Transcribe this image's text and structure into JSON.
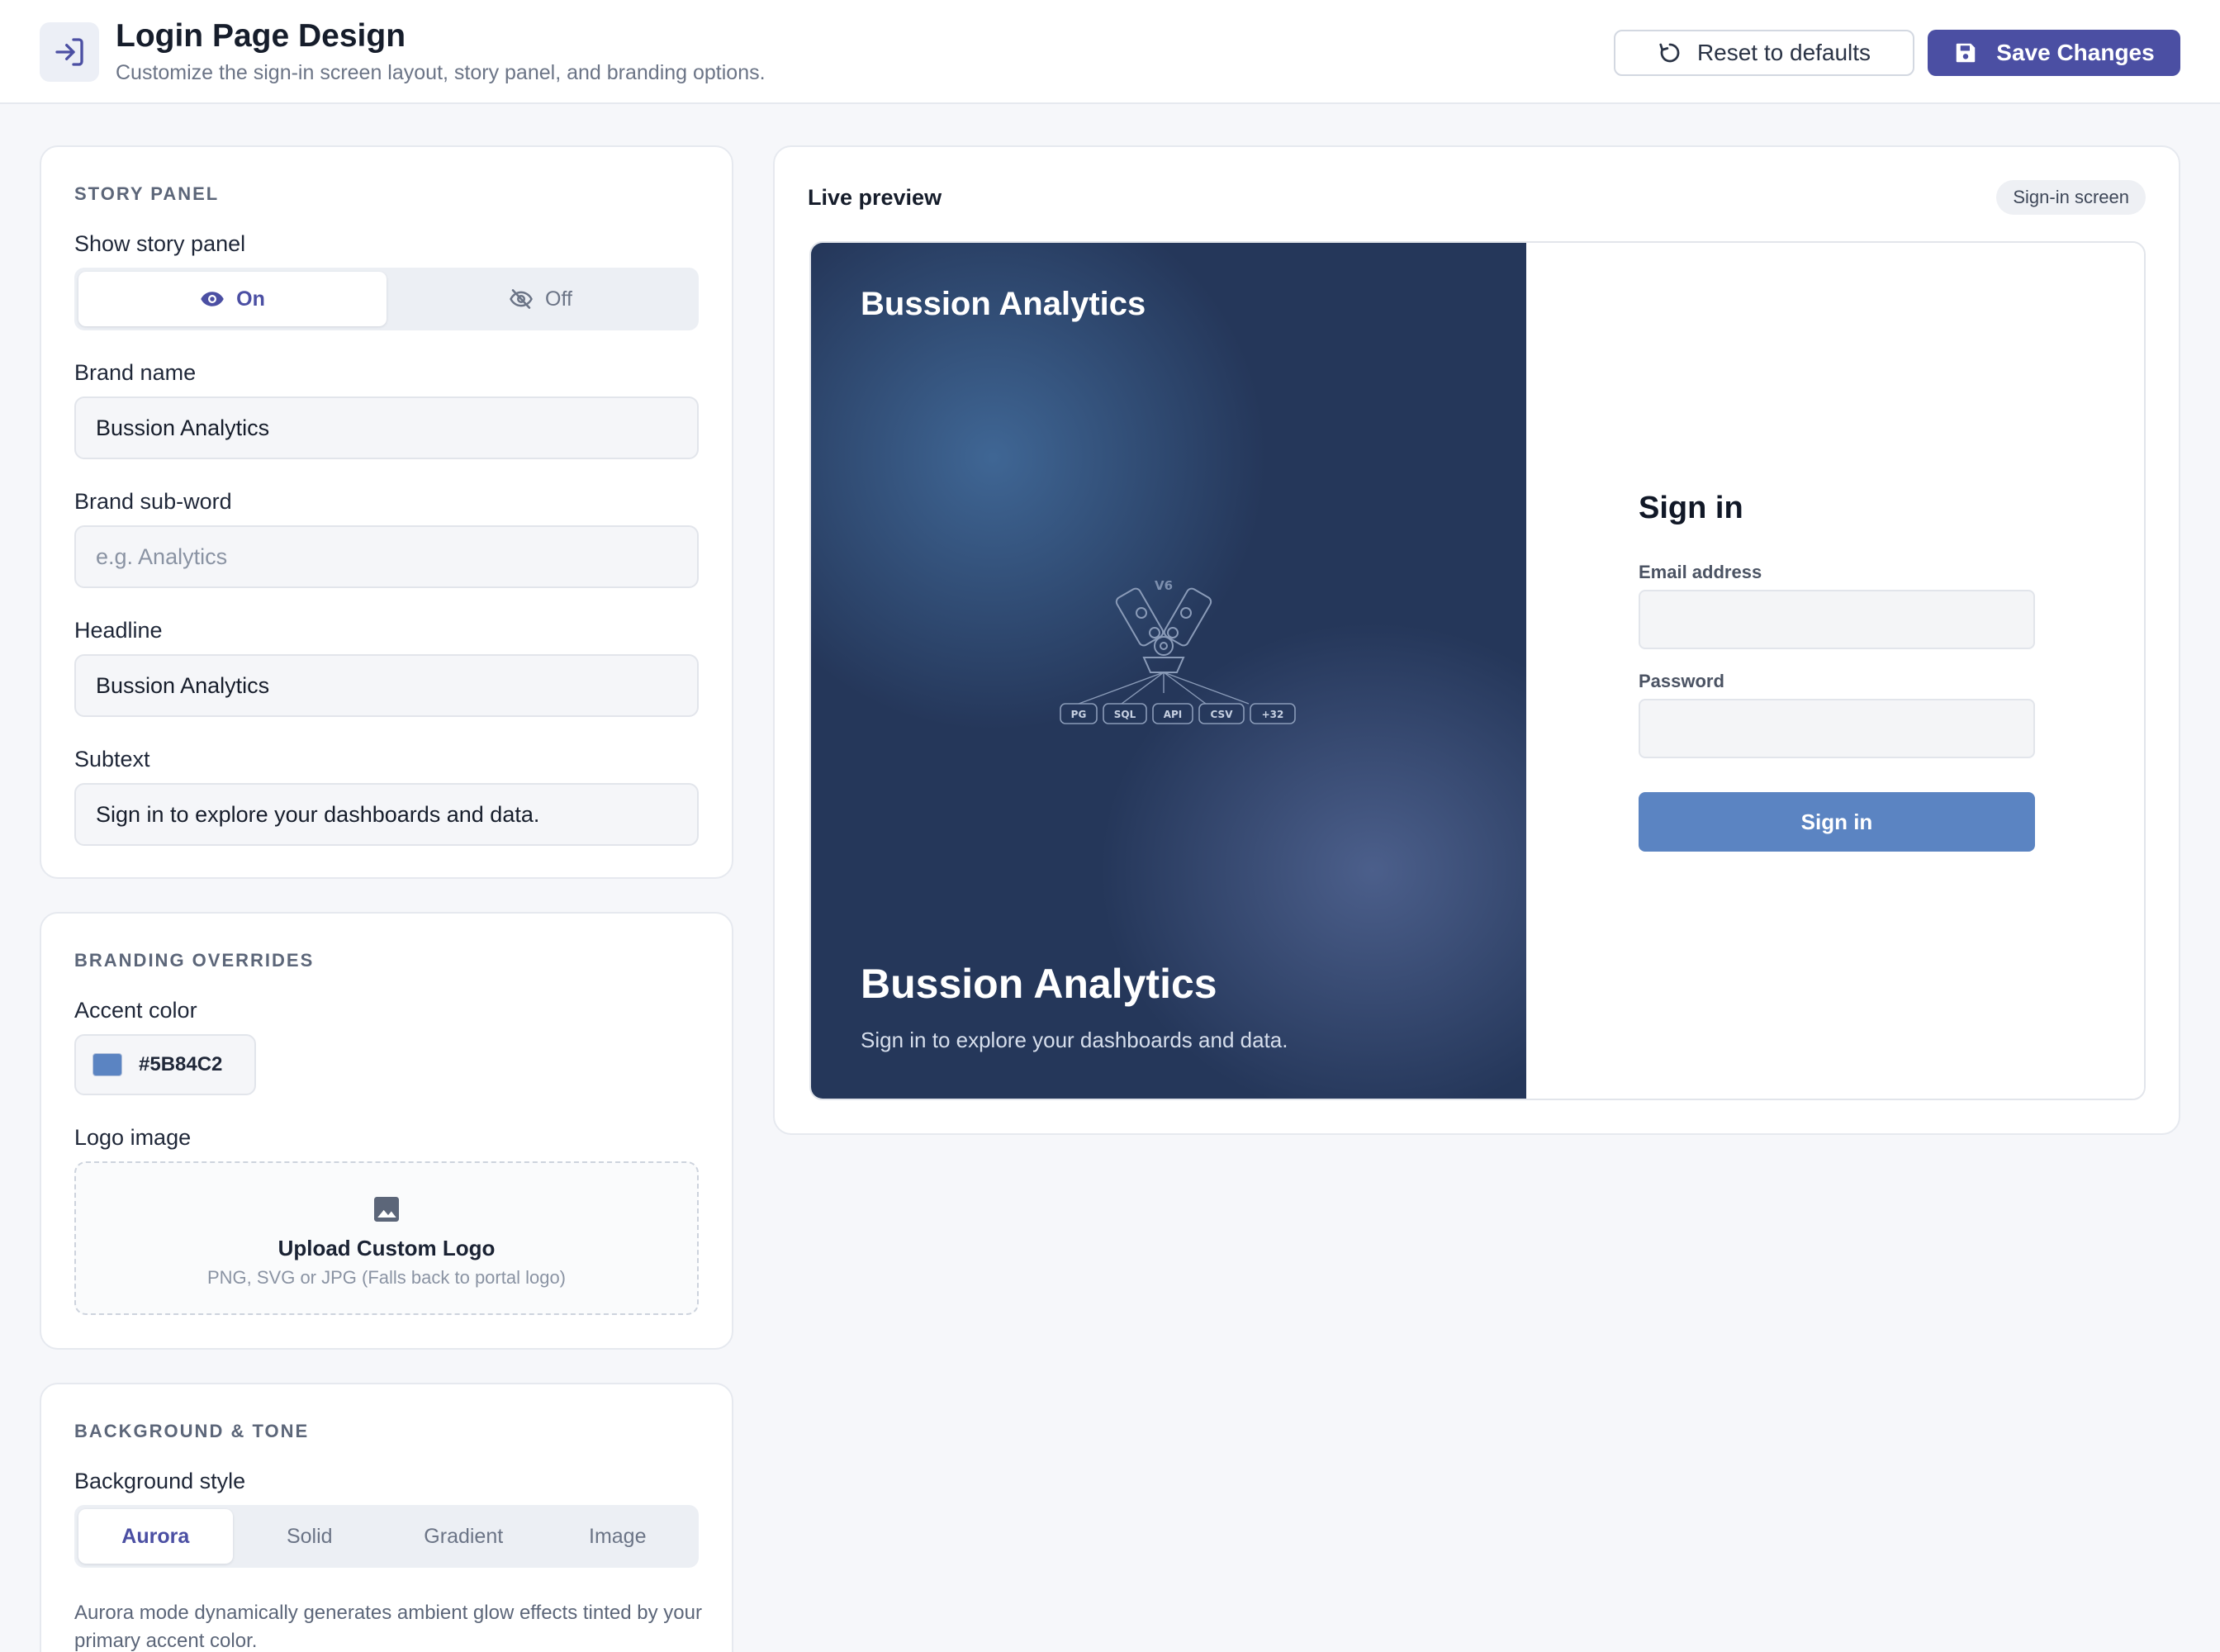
{
  "header": {
    "title": "Login Page Design",
    "subtitle": "Customize the sign-in screen layout, story panel, and branding options.",
    "icon": "login-icon",
    "reset_label": "Reset to defaults",
    "save_label": "Save Changes"
  },
  "story_panel": {
    "section_title": "STORY PANEL",
    "show_label": "Show story panel",
    "on_label": "On",
    "off_label": "Off",
    "selected": "On",
    "brand_name_label": "Brand name",
    "brand_name_value": "Bussion Analytics",
    "brand_subword_label": "Brand sub-word",
    "brand_subword_placeholder": "e.g. Analytics",
    "headline_label": "Headline",
    "headline_value": "Bussion Analytics",
    "subtext_label": "Subtext",
    "subtext_value": "Sign in to explore your dashboards and data."
  },
  "branding": {
    "section_title": "BRANDING OVERRIDES",
    "accent_label": "Accent color",
    "accent_value": "#5B84C2",
    "logo_label": "Logo image",
    "upload_title": "Upload Custom Logo",
    "upload_hint": "PNG, SVG or JPG (Falls back to portal logo)"
  },
  "background": {
    "section_title": "BACKGROUND & TONE",
    "style_label": "Background style",
    "options": [
      "Aurora",
      "Solid",
      "Gradient",
      "Image"
    ],
    "selected": "Aurora",
    "note": "Aurora mode dynamically generates ambient glow effects tinted by your primary accent color."
  },
  "preview": {
    "title": "Live preview",
    "badge": "Sign-in screen",
    "story_brand": "Bussion Analytics",
    "story_headline": "Bussion Analytics",
    "story_subtext": "Sign in to explore your dashboards and data.",
    "engine_label": "V6",
    "source_tags": [
      "PG",
      "SQL",
      "API",
      "CSV",
      "+32"
    ],
    "signin_title": "Sign in",
    "email_label": "Email address",
    "password_label": "Password",
    "signin_button": "Sign in"
  },
  "colors": {
    "primary": "#4B4FA3",
    "accent": "#5B84C2",
    "story_bg": "#25375A"
  }
}
